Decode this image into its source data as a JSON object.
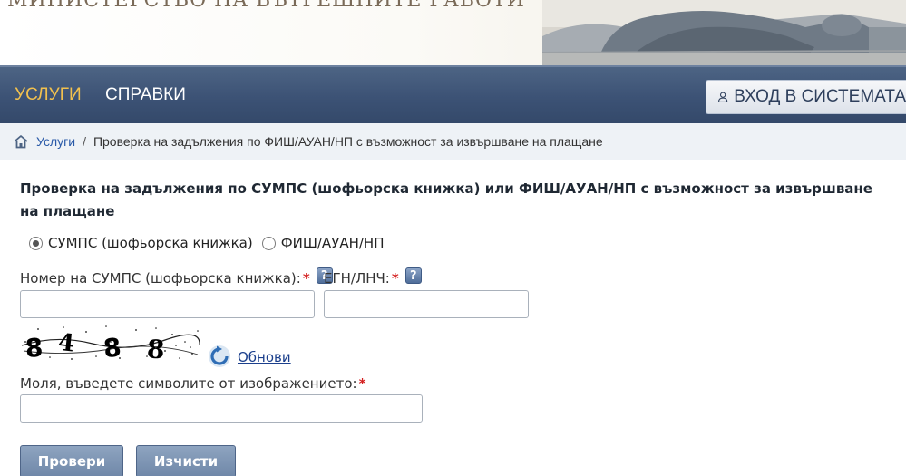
{
  "header": {
    "ministry_title": "МИНИСТЕРСТВО НА ВЪТРЕШНИТЕ РАБОТИ"
  },
  "nav": {
    "items": [
      {
        "label": "УСЛУГИ",
        "active": true
      },
      {
        "label": "СПРАВКИ",
        "active": false
      }
    ],
    "login_label": "ВХОД В СИСТЕМАТА"
  },
  "breadcrumb": {
    "home_icon": "home-icon",
    "link": "Услуги",
    "separator": "/",
    "current": "Проверка на задължения по ФИШ/АУАН/НП с възможност за извършване на плащане"
  },
  "form": {
    "title": "Проверка на задължения по СУМПС (шофьорска книжка) или ФИШ/АУАН/НП с възможност за извършване на плащане",
    "radio_options": [
      {
        "label": "СУМПС (шофьорска книжка)",
        "checked": true
      },
      {
        "label": "ФИШ/АУАН/НП",
        "checked": false
      }
    ],
    "license_label": "Номер на СУМПС (шофьорска книжка):",
    "license_value": "",
    "egn_label": "ЕГН/ЛНЧ:",
    "egn_value": "",
    "required_mark": "*",
    "help_mark": "?",
    "captcha_text": "8488",
    "refresh_label": "Обнови",
    "captcha_prompt": "Моля, въведете символите от изображението:",
    "captcha_value": "",
    "submit_label": "Провери",
    "clear_label": "Изчисти"
  },
  "colors": {
    "nav_bg": "#3c5275",
    "nav_active": "#f2c14e",
    "link": "#2a5aa8",
    "required": "#d42020",
    "button_bg": "#7d93b3"
  }
}
